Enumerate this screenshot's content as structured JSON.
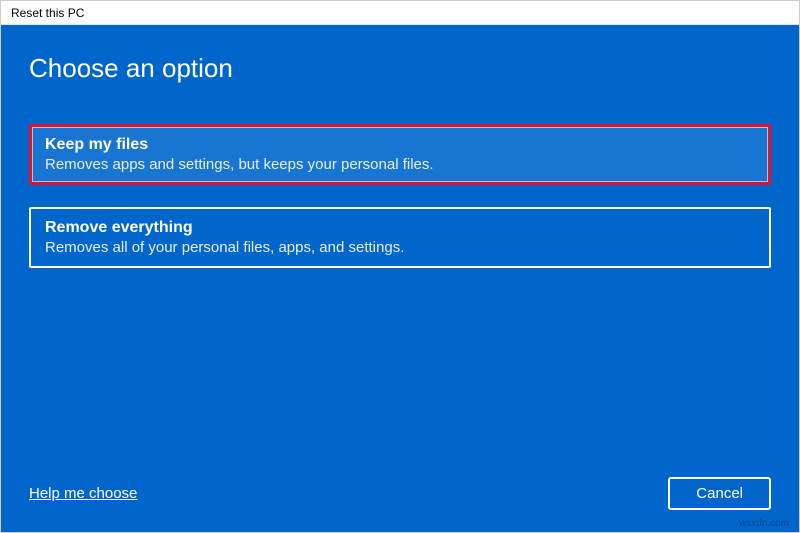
{
  "window": {
    "title": "Reset this PC"
  },
  "heading": "Choose an option",
  "options": {
    "keep": {
      "title": "Keep my files",
      "desc": "Removes apps and settings, but keeps your personal files."
    },
    "remove": {
      "title": "Remove everything",
      "desc": "Removes all of your personal files, apps, and settings."
    }
  },
  "footer": {
    "help_link": "Help me choose",
    "cancel_label": "Cancel"
  },
  "watermark": "wsxdn.com"
}
